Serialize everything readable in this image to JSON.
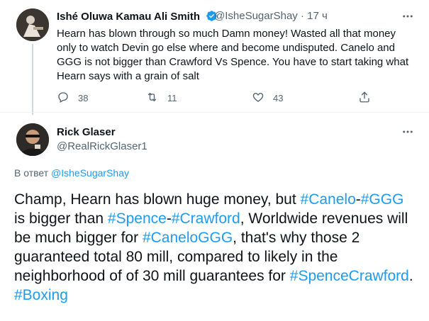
{
  "parent_tweet": {
    "author_name": "Ishé Oluwa Kamau Ali Smith",
    "handle": "@IsheSugarShay",
    "separator": "·",
    "time": "17 ч",
    "text": "Hearn has blown through so much Damn money! Wasted all that money only to watch Devin go else where and become undisputed. Canelo and GGG is not bigger than Crawford Vs Spence. You have to start taking what Hearn says with a grain of salt",
    "reply_count": "38",
    "retweet_count": "11",
    "like_count": "43",
    "icons": {
      "reply": "reply-icon",
      "retweet": "retweet-icon",
      "like": "heart-icon",
      "share": "share-icon",
      "verified": "verified-badge-icon",
      "more": "more-icon"
    }
  },
  "main_tweet": {
    "author_name": "Rick Glaser",
    "handle": "@RealRickGlaser1",
    "replying_to_prefix": "В ответ",
    "replying_to_handle": "@IsheSugarShay",
    "text_segments": [
      {
        "text": "Champ, Hearn has blown huge money, but ",
        "hashtag": false
      },
      {
        "text": "#Canelo",
        "hashtag": true
      },
      {
        "text": "-",
        "hashtag": false
      },
      {
        "text": "#GGG",
        "hashtag": true
      },
      {
        "text": " is bigger than ",
        "hashtag": false
      },
      {
        "text": "#Spence",
        "hashtag": true
      },
      {
        "text": "-",
        "hashtag": false
      },
      {
        "text": "#Crawford",
        "hashtag": true
      },
      {
        "text": ", Worldwide revenues will be much bigger for ",
        "hashtag": false
      },
      {
        "text": "#CaneloGGG",
        "hashtag": true
      },
      {
        "text": ", that's why those 2 guaranteed total 80 mill, compared to likely in the neighborhood of of 30 mill guarantees for ",
        "hashtag": false
      },
      {
        "text": "#SpenceCrawford",
        "hashtag": true
      },
      {
        "text": ". ",
        "hashtag": false
      },
      {
        "text": "#Boxing",
        "hashtag": true
      }
    ]
  },
  "colors": {
    "accent": "#1d9bf0",
    "muted": "#536471",
    "text": "#0f1419"
  }
}
